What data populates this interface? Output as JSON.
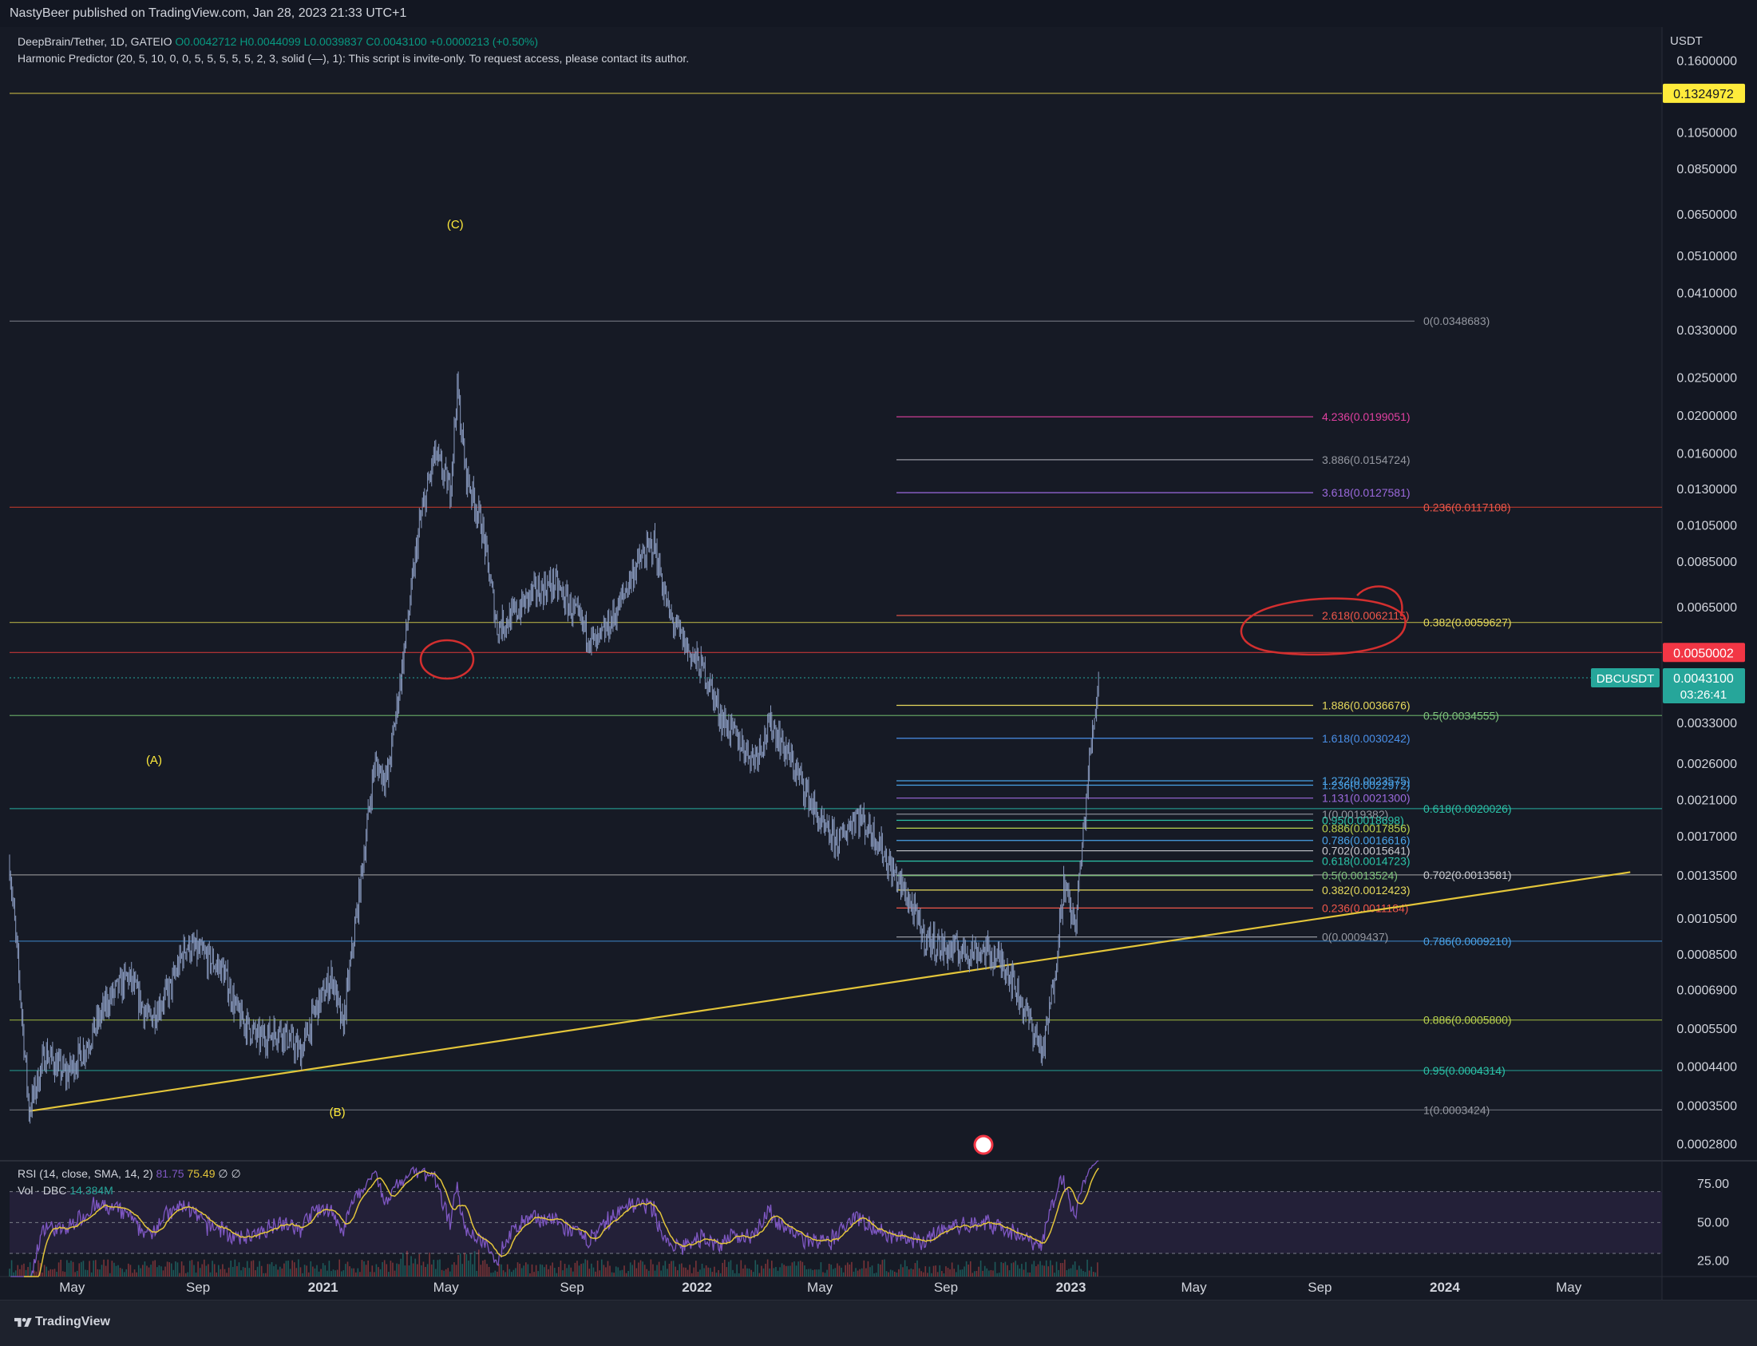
{
  "header": {
    "published": "NastyBeer published on TradingView.com, Jan 28, 2023 21:33 UTC+1"
  },
  "legend": {
    "symbol": "DeepBrain/Tether, 1D, GATEIO",
    "ohlc": "O0.0042712  H0.0044099  L0.0039837  C0.0043100  +0.0000213 (+0.50%)",
    "indicator": "Harmonic Predictor (20, 5, 10, 0, 0, 5, 5, 5, 5, 5, 2, 3, solid (—), 1): This script is invite-only. To request access, please contact its author.",
    "rsi": "RSI (14, close, SMA, 14, 2)",
    "rsi_value": "81.75",
    "rsi_ma": "75.49",
    "rsi_extra": "∅  ∅",
    "vol": "Vol · DBC",
    "vol_value": "14.384M"
  },
  "colors": {
    "background": "#161a25",
    "candles": "#8a9bc0",
    "trendline": "#e3c53a",
    "rsi_line": "#7e57c2",
    "rsi_ma": "#e3c53a",
    "rsi_band": "#2a2440",
    "accent_teal": "#26a69a",
    "accent_red": "#f23645",
    "accent_yellow": "#ffeb3b"
  },
  "chart_data": {
    "type": "candlestick",
    "y_scale": "log",
    "currency_label": "USDT",
    "ylim": [
      0.00025,
      0.19
    ],
    "price_ticks": [
      "0.1600000",
      "0.1050000",
      "0.0850000",
      "0.0650000",
      "0.0510000",
      "0.0410000",
      "0.0330000",
      "0.0250000",
      "0.0200000",
      "0.0160000",
      "0.0130000",
      "0.0105000",
      "0.0085000",
      "0.0065000",
      "0.0033000",
      "0.0026000",
      "0.0021000",
      "0.0017000",
      "0.0013500",
      "0.0010500",
      "0.0008500",
      "0.0006900",
      "0.0005500",
      "0.0004400",
      "0.0003500",
      "0.0002800"
    ],
    "time_ticks": [
      {
        "label": "May",
        "date": "2020-05-01"
      },
      {
        "label": "Sep",
        "date": "2020-09-01"
      },
      {
        "label": "2021",
        "date": "2021-01-01"
      },
      {
        "label": "May",
        "date": "2021-05-01"
      },
      {
        "label": "Sep",
        "date": "2021-09-01"
      },
      {
        "label": "2022",
        "date": "2022-01-01"
      },
      {
        "label": "May",
        "date": "2022-05-01"
      },
      {
        "label": "Sep",
        "date": "2022-09-01"
      },
      {
        "label": "2023",
        "date": "2023-01-01"
      },
      {
        "label": "May",
        "date": "2023-05-01"
      },
      {
        "label": "Sep",
        "date": "2023-09-01"
      },
      {
        "label": "2024",
        "date": "2024-01-01"
      },
      {
        "label": "May",
        "date": "2024-05-01"
      }
    ],
    "price_path": [
      [
        "2020-03-01",
        0.00145
      ],
      [
        "2020-03-12",
        0.00065
      ],
      [
        "2020-03-20",
        0.00034
      ],
      [
        "2020-04-05",
        0.00048
      ],
      [
        "2020-04-25",
        0.00042
      ],
      [
        "2020-05-15",
        0.0005
      ],
      [
        "2020-06-05",
        0.00065
      ],
      [
        "2020-06-25",
        0.00075
      ],
      [
        "2020-07-15",
        0.00058
      ],
      [
        "2020-08-05",
        0.0007
      ],
      [
        "2020-08-20",
        0.0009
      ],
      [
        "2020-09-05",
        0.00085
      ],
      [
        "2020-09-25",
        0.00078
      ],
      [
        "2020-10-10",
        0.0006
      ],
      [
        "2020-10-30",
        0.00052
      ],
      [
        "2020-11-20",
        0.00055
      ],
      [
        "2020-12-10",
        0.00048
      ],
      [
        "2020-12-25",
        0.00062
      ],
      [
        "2021-01-10",
        0.00075
      ],
      [
        "2021-01-20",
        0.00055
      ],
      [
        "2021-02-05",
        0.0012
      ],
      [
        "2021-02-20",
        0.0026
      ],
      [
        "2021-03-05",
        0.0024
      ],
      [
        "2021-03-20",
        0.0048
      ],
      [
        "2021-04-05",
        0.0105
      ],
      [
        "2021-04-20",
        0.016
      ],
      [
        "2021-05-05",
        0.013
      ],
      [
        "2021-05-12",
        0.0235
      ],
      [
        "2021-05-20",
        0.0145
      ],
      [
        "2021-06-05",
        0.0105
      ],
      [
        "2021-06-20",
        0.0058
      ],
      [
        "2021-07-05",
        0.0062
      ],
      [
        "2021-07-25",
        0.0071
      ],
      [
        "2021-08-15",
        0.0075
      ],
      [
        "2021-09-05",
        0.0062
      ],
      [
        "2021-09-25",
        0.0052
      ],
      [
        "2021-10-15",
        0.0064
      ],
      [
        "2021-11-01",
        0.0082
      ],
      [
        "2021-11-20",
        0.0095
      ],
      [
        "2021-12-05",
        0.0062
      ],
      [
        "2021-12-25",
        0.005
      ],
      [
        "2022-01-10",
        0.0044
      ],
      [
        "2022-01-25",
        0.0034
      ],
      [
        "2022-02-10",
        0.003
      ],
      [
        "2022-02-25",
        0.0027
      ],
      [
        "2022-03-15",
        0.0033
      ],
      [
        "2022-04-01",
        0.0027
      ],
      [
        "2022-04-15",
        0.0023
      ],
      [
        "2022-05-05",
        0.00175
      ],
      [
        "2022-05-20",
        0.00165
      ],
      [
        "2022-06-05",
        0.00195
      ],
      [
        "2022-06-25",
        0.0017
      ],
      [
        "2022-07-10",
        0.0014
      ],
      [
        "2022-07-25",
        0.0012
      ],
      [
        "2022-08-10",
        0.00095
      ],
      [
        "2022-08-30",
        0.00088
      ],
      [
        "2022-09-20",
        0.00087
      ],
      [
        "2022-10-10",
        0.00087
      ],
      [
        "2022-10-30",
        0.0008
      ],
      [
        "2022-11-10",
        0.00068
      ],
      [
        "2022-11-25",
        0.00055
      ],
      [
        "2022-12-05",
        0.00048
      ],
      [
        "2022-12-15",
        0.00072
      ],
      [
        "2022-12-25",
        0.0013
      ],
      [
        "2023-01-05",
        0.001
      ],
      [
        "2023-01-12",
        0.0016
      ],
      [
        "2023-01-20",
        0.0028
      ],
      [
        "2023-01-28",
        0.0043
      ]
    ],
    "last_price": "0.0043100",
    "last_price_label": "DBCUSDT",
    "countdown": "03:26:41",
    "price_tags": [
      {
        "value": 0.1324972,
        "label": "0.1324972",
        "color": "#ffeb3b",
        "text": "#131722"
      },
      {
        "value": 0.0050002,
        "label": "0.0050002",
        "color": "#f23645",
        "text": "#ffffff"
      }
    ],
    "horizontal_lines": [
      {
        "value": 0.1324972,
        "color": "#e3d04a"
      },
      {
        "value": 0.0117108,
        "color": "#c0392b"
      },
      {
        "value": 0.0059627,
        "color": "#c9c24a"
      },
      {
        "value": 0.0050002,
        "color": "#e03a3a"
      },
      {
        "value": 0.0034555,
        "color": "#6cb46a"
      },
      {
        "value": 0.0020026,
        "color": "#26a69a"
      },
      {
        "value": 0.0013581,
        "color": "#9e9e9e"
      },
      {
        "value": 0.000921,
        "color": "#3b82c4"
      },
      {
        "value": 0.00058,
        "color": "#a7c241"
      },
      {
        "value": 0.0004314,
        "color": "#26a69a"
      },
      {
        "value": 0.0003424,
        "color": "#787b86"
      },
      {
        "value": 0.0348683,
        "color": "#787b86"
      }
    ],
    "fib_retracement": [
      {
        "label": "0(0.0348683)",
        "value": 0.0348683,
        "color": "#9598a1"
      },
      {
        "label": "0.236(0.0117108)",
        "value": 0.0117108,
        "color": "#f0574a"
      },
      {
        "label": "0.382(0.0059627)",
        "value": 0.0059627,
        "color": "#e6d95c"
      },
      {
        "label": "0.5(0.0034555)",
        "value": 0.0034555,
        "color": "#7fc47c"
      },
      {
        "label": "0.618(0.0020026)",
        "value": 0.0020026,
        "color": "#2bc4a8"
      },
      {
        "label": "0.702(0.0013581)",
        "value": 0.0013581,
        "color": "#c8cad0"
      },
      {
        "label": "0.786(0.0009210)",
        "value": 0.000921,
        "color": "#4aa3e8"
      },
      {
        "label": "0.886(0.0005800)",
        "value": 0.00058,
        "color": "#b9d24f"
      },
      {
        "label": "0.95(0.0004314)",
        "value": 0.0004314,
        "color": "#2bc4a8"
      },
      {
        "label": "1(0.0003424)",
        "value": 0.0003424,
        "color": "#9598a1"
      }
    ],
    "fib_extension": [
      {
        "label": "4.236(0.0199051)",
        "value": 0.0199051,
        "color": "#e040a0"
      },
      {
        "label": "3.886(0.0154724)",
        "value": 0.0154724,
        "color": "#9598a1"
      },
      {
        "label": "3.618(0.0127581)",
        "value": 0.0127581,
        "color": "#9c6ade"
      },
      {
        "label": "2.618(0.0062115)",
        "value": 0.0062115,
        "color": "#f0574a"
      },
      {
        "label": "1.886(0.0036676)",
        "value": 0.0036676,
        "color": "#e6d95c"
      },
      {
        "label": "1.618(0.0030242)",
        "value": 0.0030242,
        "color": "#4a8fe8"
      },
      {
        "label": "1.272(0.0023575)",
        "value": 0.0023575,
        "color": "#4aa3e8"
      },
      {
        "label": "1.236(0.0022972)",
        "value": 0.0022972,
        "color": "#4aa3e8"
      },
      {
        "label": "1.131(0.0021300)",
        "value": 0.00213,
        "color": "#9c6ade"
      },
      {
        "label": "1(0.0019382)",
        "value": 0.0019382,
        "color": "#9598a1"
      },
      {
        "label": "0.95(0.0018698)",
        "value": 0.0018698,
        "color": "#2bc4a8"
      },
      {
        "label": "0.886(0.0017856)",
        "value": 0.0017856,
        "color": "#b9d24f"
      },
      {
        "label": "0.786(0.0016616)",
        "value": 0.0016616,
        "color": "#4aa3e8"
      },
      {
        "label": "0.702(0.0015641)",
        "value": 0.0015641,
        "color": "#c8cad0"
      },
      {
        "label": "0.618(0.0014723)",
        "value": 0.0014723,
        "color": "#2bc4a8"
      },
      {
        "label": "0.5(0.0013524)",
        "value": 0.0013524,
        "color": "#7fc47c"
      },
      {
        "label": "0.382(0.0012423)",
        "value": 0.0012423,
        "color": "#e6d95c"
      },
      {
        "label": "0.236(0.0011184)",
        "value": 0.0011184,
        "color": "#f0574a"
      },
      {
        "label": "0(0.0009437)",
        "value": 0.0009437,
        "color": "#9598a1"
      }
    ],
    "wave_labels": [
      {
        "label": "(A)",
        "date": "2020-07-20",
        "value": 0.0026
      },
      {
        "label": "(B)",
        "date": "2021-01-15",
        "value": 0.00033
      },
      {
        "label": "(C)",
        "date": "2021-05-10",
        "value": 0.06
      }
    ],
    "trendline": {
      "start": [
        "2020-03-20",
        0.00034
      ],
      "end": [
        "2024-06-30",
        0.00138
      ]
    },
    "rsi": {
      "ylim": [
        15,
        90
      ],
      "ticks": [
        "75.00",
        "50.00",
        "25.00"
      ],
      "band": [
        30,
        70
      ]
    }
  }
}
